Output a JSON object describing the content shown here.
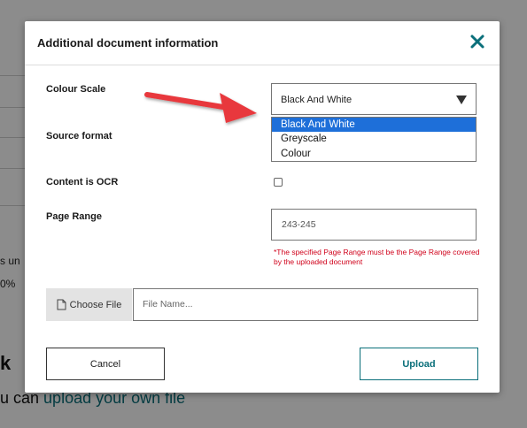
{
  "background": {
    "partial_text_1": "s un",
    "partial_text_2": "0%",
    "heading_fragment": "k",
    "link_prefix": "u can ",
    "link_text": "upload your own file"
  },
  "dialog": {
    "title": "Additional document information",
    "close_icon": "close-x-icon",
    "colour_scale": {
      "label": "Colour Scale",
      "selected": "Black And White",
      "options": [
        "Black And White",
        "Greyscale",
        "Colour"
      ]
    },
    "source_format": {
      "label": "Source format"
    },
    "content_ocr": {
      "label": "Content is OCR",
      "checked": false
    },
    "page_range": {
      "label": "Page Range",
      "value": "243-245",
      "hint": "*The specified Page Range must be the Page Range covered by the uploaded document"
    },
    "file": {
      "choose_label": "Choose File",
      "file_icon": "file-icon",
      "placeholder": "File Name..."
    },
    "buttons": {
      "cancel": "Cancel",
      "upload": "Upload"
    }
  },
  "colors": {
    "accent": "#0a6f7a",
    "selection": "#1e6fd9",
    "error": "#d0021b",
    "annotation_arrow": "#e8393c"
  }
}
